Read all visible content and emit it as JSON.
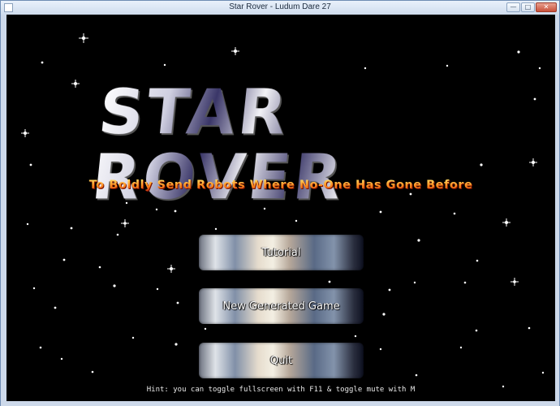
{
  "window": {
    "title": "Star Rover - Ludum Dare 27",
    "minimize_glyph": "—",
    "maximize_glyph": "□",
    "close_glyph": "✕"
  },
  "logo": {
    "title": "STAR ROVER",
    "tagline": "To Boldly Send Robots Where No-One Has Gone Before"
  },
  "menu": {
    "tutorial": "Tutorial",
    "new_game": "New Generated Game",
    "quit": "Quit"
  },
  "hint": "Hint: you can toggle fullscreen with F11 & toggle mute with M",
  "colors": {
    "background": "#000000",
    "tagline_top": "#ffe46a",
    "tagline_bottom": "#c83010"
  }
}
